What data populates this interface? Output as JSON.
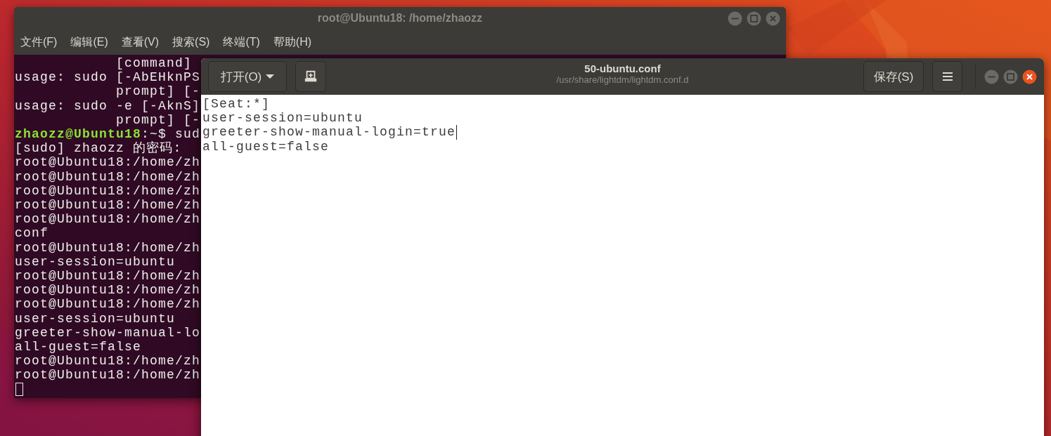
{
  "terminal": {
    "title": "root@Ubuntu18: /home/zhaozz",
    "focused": false,
    "menu": [
      "文件(F)",
      "编辑(E)",
      "查看(V)",
      "搜索(S)",
      "终端(T)",
      "帮助(H)"
    ],
    "lines": [
      {
        "kind": "output",
        "text": "            [command]"
      },
      {
        "kind": "output",
        "text": "usage: sudo [-AbEHknPS"
      },
      {
        "kind": "output",
        "text": "            prompt] [-"
      },
      {
        "kind": "output",
        "text": "usage: sudo -e [-AknS]"
      },
      {
        "kind": "output",
        "text": "            prompt] [-"
      },
      {
        "kind": "prompt",
        "user": "zhaozz@Ubuntu18",
        "text": ":~$ sud"
      },
      {
        "kind": "output",
        "text": "[sudo] zhaozz 的密码:"
      },
      {
        "kind": "output",
        "text": "root@Ubuntu18:/home/zh"
      },
      {
        "kind": "output",
        "text": "root@Ubuntu18:/home/zh"
      },
      {
        "kind": "output",
        "text": "root@Ubuntu18:/home/zh"
      },
      {
        "kind": "output",
        "text": "root@Ubuntu18:/home/zh"
      },
      {
        "kind": "output",
        "text": "root@Ubuntu18:/home/zh"
      },
      {
        "kind": "output",
        "text": "conf"
      },
      {
        "kind": "output",
        "text": "root@Ubuntu18:/home/zh"
      },
      {
        "kind": "output",
        "text": "user-session=ubuntu"
      },
      {
        "kind": "output",
        "text": "root@Ubuntu18:/home/zh"
      },
      {
        "kind": "output",
        "text": "root@Ubuntu18:/home/zh"
      },
      {
        "kind": "output",
        "text": "root@Ubuntu18:/home/zh"
      },
      {
        "kind": "output",
        "text": "user-session=ubuntu"
      },
      {
        "kind": "output",
        "text": "greeter-show-manual-lo"
      },
      {
        "kind": "output",
        "text": "all-guest=false"
      },
      {
        "kind": "output",
        "text": "root@Ubuntu18:/home/zh"
      },
      {
        "kind": "output",
        "text": "root@Ubuntu18:/home/zh"
      },
      {
        "kind": "cursor"
      }
    ]
  },
  "editor": {
    "title": "50-ubuntu.conf",
    "subtitle": "/usr/share/lightdm/lightdm.conf.d",
    "focused": true,
    "open_button": "打开(O)",
    "save_button": "保存(S)",
    "lines": [
      {
        "text": "[Seat:*]",
        "cursor": false
      },
      {
        "text": "user-session=ubuntu",
        "cursor": false
      },
      {
        "text": "greeter-show-manual-login=true",
        "cursor": true
      },
      {
        "text": "all-guest=false",
        "cursor": false
      }
    ]
  }
}
